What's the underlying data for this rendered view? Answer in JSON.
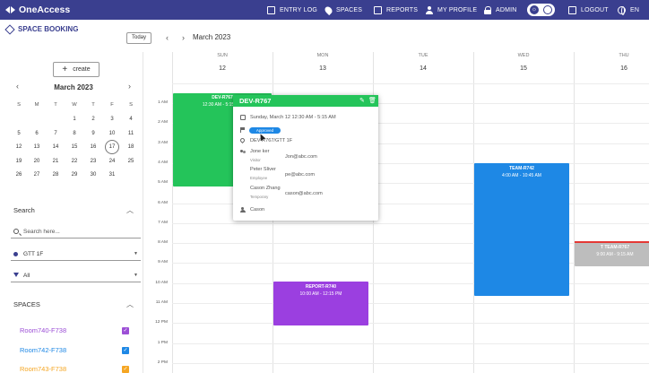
{
  "brand": {
    "name": "OneAccess"
  },
  "nav": [
    {
      "label": "ENTRY LOG",
      "icon": "entry-log-icon"
    },
    {
      "label": "SPACES",
      "icon": "location-pin-icon"
    },
    {
      "label": "REPORTS",
      "icon": "reports-icon"
    },
    {
      "label": "MY PROFILE",
      "icon": "person-icon"
    },
    {
      "label": "ADMIN",
      "icon": "lock-icon"
    },
    {
      "label": "LOGOUT",
      "icon": "logout-icon"
    },
    {
      "label": "EN",
      "icon": "globe-icon"
    }
  ],
  "page": {
    "title": "SPACE BOOKING",
    "today_label": "Today",
    "current_month": "March 2023"
  },
  "sidebar": {
    "create_label": "create",
    "mini_calendar": {
      "month": "March 2023",
      "weekdays": [
        "S",
        "M",
        "T",
        "W",
        "T",
        "F",
        "S"
      ],
      "weeks": [
        [
          "",
          "",
          "",
          "1",
          "2",
          "3",
          "4"
        ],
        [
          "5",
          "6",
          "7",
          "8",
          "9",
          "10",
          "11"
        ],
        [
          "12",
          "13",
          "14",
          "15",
          "16",
          "17",
          "18"
        ],
        [
          "19",
          "20",
          "21",
          "22",
          "23",
          "24",
          "25"
        ],
        [
          "26",
          "27",
          "28",
          "29",
          "30",
          "31",
          ""
        ]
      ],
      "selected_day": "17"
    },
    "search": {
      "label": "Search",
      "placeholder": "Search here..."
    },
    "location_value": "GTT 1F",
    "filter_value": "All",
    "spaces": {
      "label": "SPACES",
      "items": [
        {
          "name": "Room740-F738",
          "color": "#9c4fd6",
          "checked": true
        },
        {
          "name": "Room742-F738",
          "color": "#1e88e5",
          "checked": true
        },
        {
          "name": "Room743-F738",
          "color": "#f5a623",
          "checked": true
        }
      ]
    }
  },
  "calendar": {
    "days": [
      {
        "dow": "SUN",
        "num": "12"
      },
      {
        "dow": "MON",
        "num": "13"
      },
      {
        "dow": "TUE",
        "num": "14"
      },
      {
        "dow": "WED",
        "num": "15"
      },
      {
        "dow": "THU",
        "num": "16"
      }
    ],
    "hours": [
      "1 AM",
      "2 AM",
      "3 AM",
      "4 AM",
      "5 AM",
      "6 AM",
      "7 AM",
      "8 AM",
      "9 AM",
      "10 AM",
      "11 AM",
      "12 PM",
      "1 PM",
      "2 PM"
    ],
    "events": [
      {
        "title": "DEV-R767",
        "time": "12:30 AM - 5:15 PM",
        "color": "#24c45a"
      },
      {
        "title": "TEAM-R742",
        "time": "4:00 AM - 10:45 AM",
        "color": "#1e88e5"
      },
      {
        "title": "REPORT-R740",
        "time": "10:00 AM - 12:15 PM",
        "color": "#9b3fe0"
      },
      {
        "title": "T TEAM-R767",
        "time": "9:00 AM - 9:15 AM",
        "color": "#bdbdbd"
      }
    ]
  },
  "popover": {
    "title": "DEV-R767",
    "datetime": "Sunday, March 12 12:30 AM - 5:15 AM",
    "status": "Approved",
    "location": "DEV-R767/GTT 1F",
    "attendees": [
      {
        "name": "Jone ker",
        "role": "Visitor",
        "email": "Jon@abc.com"
      },
      {
        "name": "Peter Sliver",
        "role": "Employee",
        "email": "pe@abc.com"
      },
      {
        "name": "Cason Zhang",
        "role": "Temporary",
        "email": "cason@abc.com"
      }
    ],
    "organizer": "Cason"
  }
}
